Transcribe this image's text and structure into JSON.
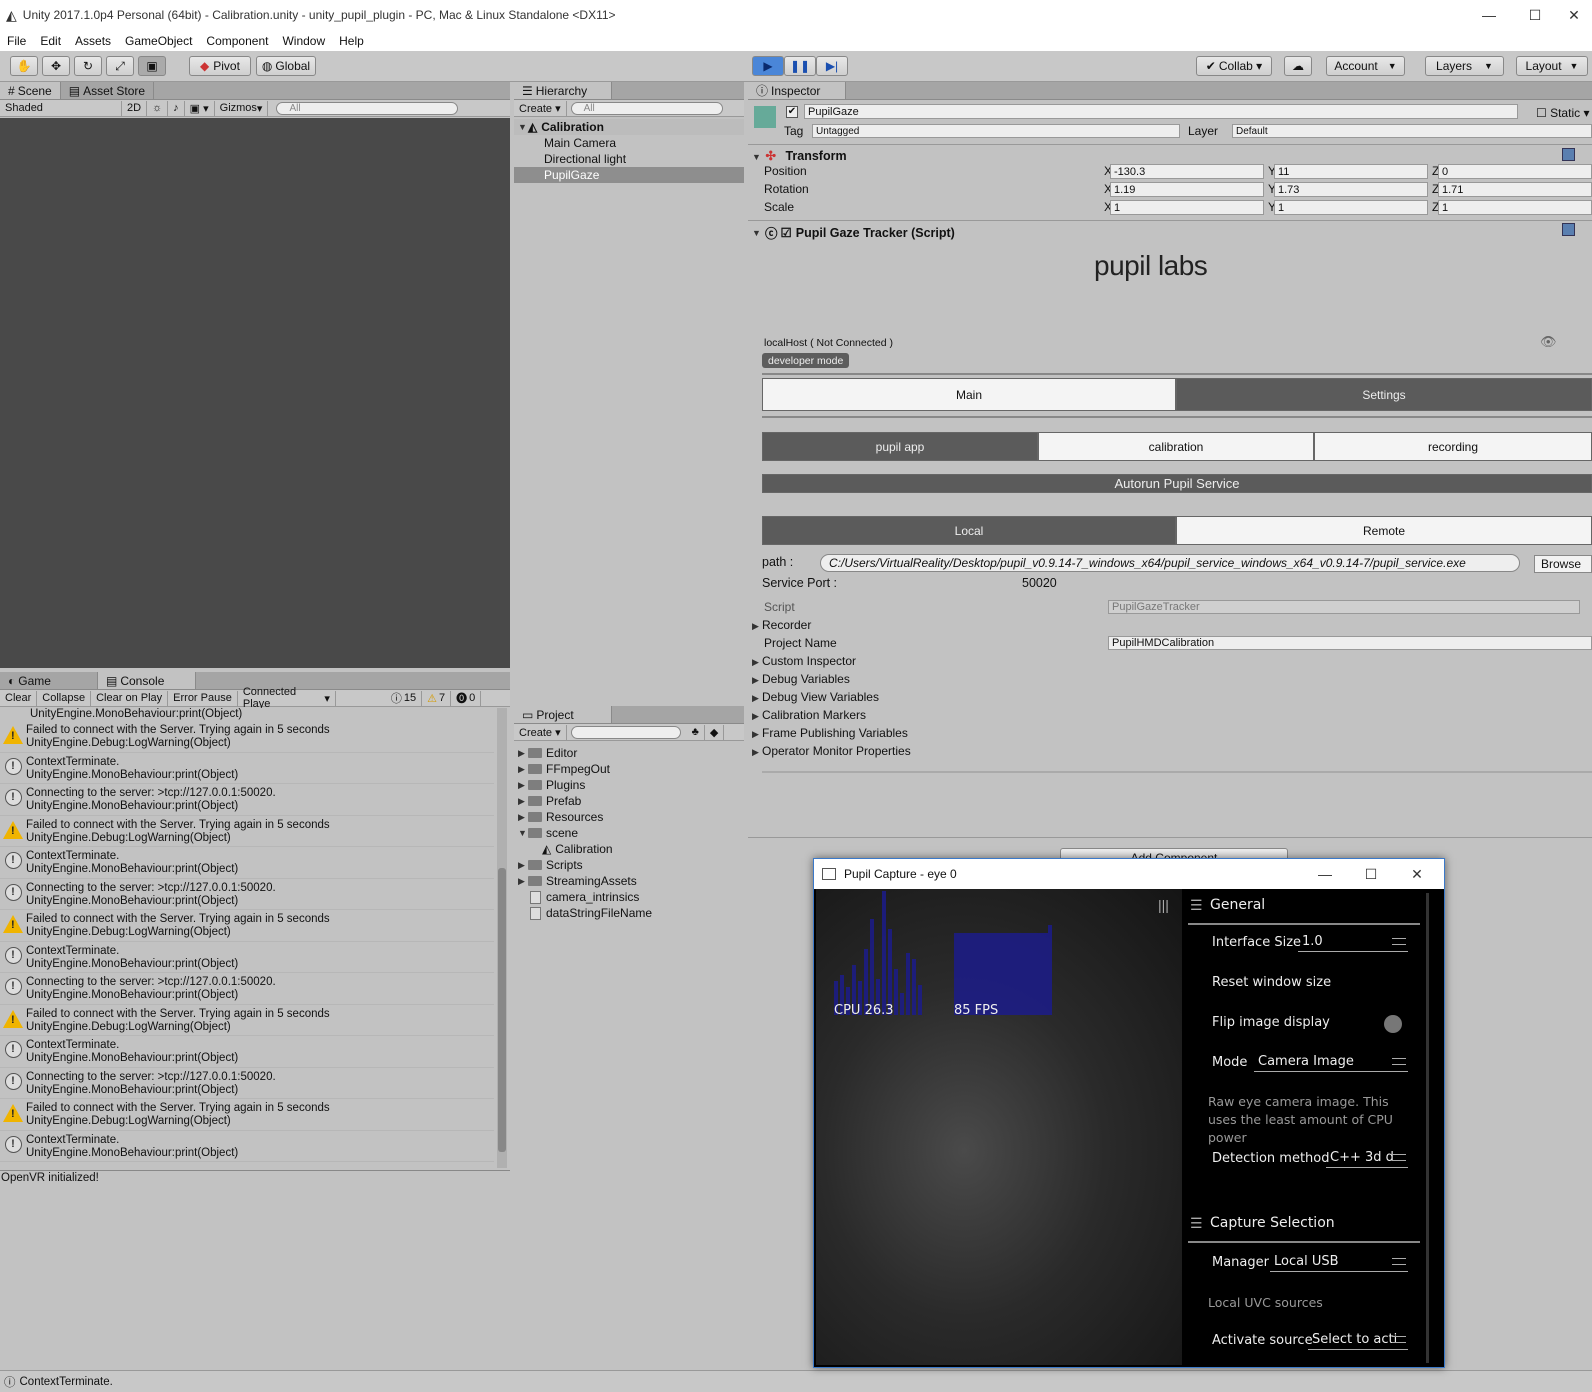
{
  "window": {
    "title": "Unity 2017.1.0p4 Personal (64bit) - Calibration.unity - unity_pupil_plugin - PC, Mac & Linux Standalone <DX11>"
  },
  "menu": [
    "File",
    "Edit",
    "Assets",
    "GameObject",
    "Component",
    "Window",
    "Help"
  ],
  "toolbar": {
    "pivot": "Pivot",
    "global": "Global",
    "collab": "Collab ▾",
    "account": "Account",
    "layers": "Layers",
    "layout": "Layout"
  },
  "scene": {
    "tab_scene": "Scene",
    "tab_asset_store": "Asset Store",
    "shaded": "Shaded",
    "btn_2d": "2D",
    "gizmos": "Gizmos",
    "search_placeholder": "All"
  },
  "console": {
    "tab_game": "Game",
    "tab_console": "Console",
    "clear": "Clear",
    "collapse": "Collapse",
    "clear_on_play": "Clear on Play",
    "error_pause": "Error Pause",
    "connected": "Connected Playe",
    "count_info": "15",
    "count_warn": "7",
    "count_err": "0",
    "top_line": "UnityEngine.MonoBehaviour:print(Object)",
    "rows": [
      {
        "type": "warn",
        "l1": "Failed to connect with the Server. Trying again in 5 seconds",
        "l2": "UnityEngine.Debug:LogWarning(Object)"
      },
      {
        "type": "info",
        "l1": "ContextTerminate.",
        "l2": "UnityEngine.MonoBehaviour:print(Object)"
      },
      {
        "type": "info",
        "l1": "Connecting to the server: >tcp://127.0.0.1:50020.",
        "l2": "UnityEngine.MonoBehaviour:print(Object)"
      },
      {
        "type": "warn",
        "l1": "Failed to connect with the Server. Trying again in 5 seconds",
        "l2": "UnityEngine.Debug:LogWarning(Object)"
      },
      {
        "type": "info",
        "l1": "ContextTerminate.",
        "l2": "UnityEngine.MonoBehaviour:print(Object)"
      },
      {
        "type": "info",
        "l1": "Connecting to the server: >tcp://127.0.0.1:50020.",
        "l2": "UnityEngine.MonoBehaviour:print(Object)"
      },
      {
        "type": "warn",
        "l1": "Failed to connect with the Server. Trying again in 5 seconds",
        "l2": "UnityEngine.Debug:LogWarning(Object)"
      },
      {
        "type": "info",
        "l1": "ContextTerminate.",
        "l2": "UnityEngine.MonoBehaviour:print(Object)"
      },
      {
        "type": "info",
        "l1": "Connecting to the server: >tcp://127.0.0.1:50020.",
        "l2": "UnityEngine.MonoBehaviour:print(Object)"
      },
      {
        "type": "warn",
        "l1": "Failed to connect with the Server. Trying again in 5 seconds",
        "l2": "UnityEngine.Debug:LogWarning(Object)"
      },
      {
        "type": "info",
        "l1": "ContextTerminate.",
        "l2": "UnityEngine.MonoBehaviour:print(Object)"
      },
      {
        "type": "info",
        "l1": "Connecting to the server: >tcp://127.0.0.1:50020.",
        "l2": "UnityEngine.MonoBehaviour:print(Object)"
      },
      {
        "type": "warn",
        "l1": "Failed to connect with the Server. Trying again in 5 seconds",
        "l2": "UnityEngine.Debug:LogWarning(Object)"
      },
      {
        "type": "info",
        "l1": "ContextTerminate.",
        "l2": "UnityEngine.MonoBehaviour:print(Object)"
      }
    ],
    "detail": "OpenVR initialized!"
  },
  "status_bar": "ContextTerminate.",
  "hierarchy": {
    "tab": "Hierarchy",
    "create": "Create ▾",
    "search": "All",
    "scene": "Calibration",
    "items": [
      "Main Camera",
      "Directional light",
      "PupilGaze"
    ]
  },
  "project": {
    "tab": "Project",
    "create": "Create ▾",
    "items": [
      {
        "name": "Editor",
        "kind": "folder",
        "open": false
      },
      {
        "name": "FFmpegOut",
        "kind": "folder",
        "open": false
      },
      {
        "name": "Plugins",
        "kind": "folder",
        "open": false
      },
      {
        "name": "Prefab",
        "kind": "folder",
        "open": false
      },
      {
        "name": "Resources",
        "kind": "folder",
        "open": false
      },
      {
        "name": "scene",
        "kind": "folder",
        "open": true
      },
      {
        "name": "Calibration",
        "kind": "unity",
        "open": false
      },
      {
        "name": "Scripts",
        "kind": "folder",
        "open": false
      },
      {
        "name": "StreamingAssets",
        "kind": "folder",
        "open": false
      },
      {
        "name": "camera_intrinsics",
        "kind": "file",
        "open": false
      },
      {
        "name": "dataStringFileName",
        "kind": "file",
        "open": false
      }
    ]
  },
  "inspector": {
    "tab": "Inspector",
    "object_name": "PupilGaze",
    "static": "Static ▾",
    "tag_label": "Tag",
    "tag": "Untagged",
    "layer_label": "Layer",
    "layer": "Default",
    "transform": {
      "title": "Transform",
      "rows": [
        {
          "label": "Position",
          "x": "-130.3",
          "y": "11",
          "z": "0"
        },
        {
          "label": "Rotation",
          "x": "1.19",
          "y": "1.73",
          "z": "1.71"
        },
        {
          "label": "Scale",
          "x": "1",
          "y": "1",
          "z": "1"
        }
      ]
    },
    "script_title": "Pupil Gaze Tracker (Script)",
    "logo": "pupil labs",
    "host": "localHost ( Not Connected )",
    "dev_mode": "developer mode",
    "tabs": {
      "main": "Main",
      "settings": "Settings"
    },
    "subtabs": {
      "pupil_app": "pupil app",
      "calibration": "calibration",
      "recording": "recording"
    },
    "autorun": "Autorun Pupil Service",
    "mode": {
      "local": "Local",
      "remote": "Remote"
    },
    "path_label": "path :",
    "path": "C:/Users/VirtualReality/Desktop/pupil_v0.9.14-7_windows_x64/pupil_service_windows_x64_v0.9.14-7/pupil_service.exe",
    "browse": "Browse",
    "port_label": "Service Port :",
    "port": "50020",
    "script_label": "Script",
    "script_value": "PupilGazeTracker",
    "recorder": "Recorder",
    "project_name_label": "Project Name",
    "project_name": "PupilHMDCalibration",
    "foldouts": [
      "Custom Inspector",
      "Debug Variables",
      "Debug View Variables",
      "Calibration Markers",
      "Frame Publishing Variables",
      "Operator Monitor Properties"
    ],
    "add_component": "Add Component"
  },
  "pupil_capture": {
    "title": "Pupil Capture - eye 0",
    "cpu": "CPU 26.3",
    "fps": "85 FPS",
    "general": "General",
    "interface_size_label": "Interface Size",
    "interface_size": "1.0",
    "reset": "Reset window size",
    "flip": "Flip image display",
    "mode_label": "Mode",
    "mode": "Camera Image",
    "desc": "Raw eye camera image. This uses the least amount of CPU power",
    "detection_label": "Detection method",
    "detection": "C++ 3d d",
    "capture_selection": "Capture Selection",
    "manager_label": "Manager",
    "manager": "Local USB",
    "uvc": "Local UVC sources",
    "activate_label": "Activate source",
    "activate": "Select to acti"
  }
}
